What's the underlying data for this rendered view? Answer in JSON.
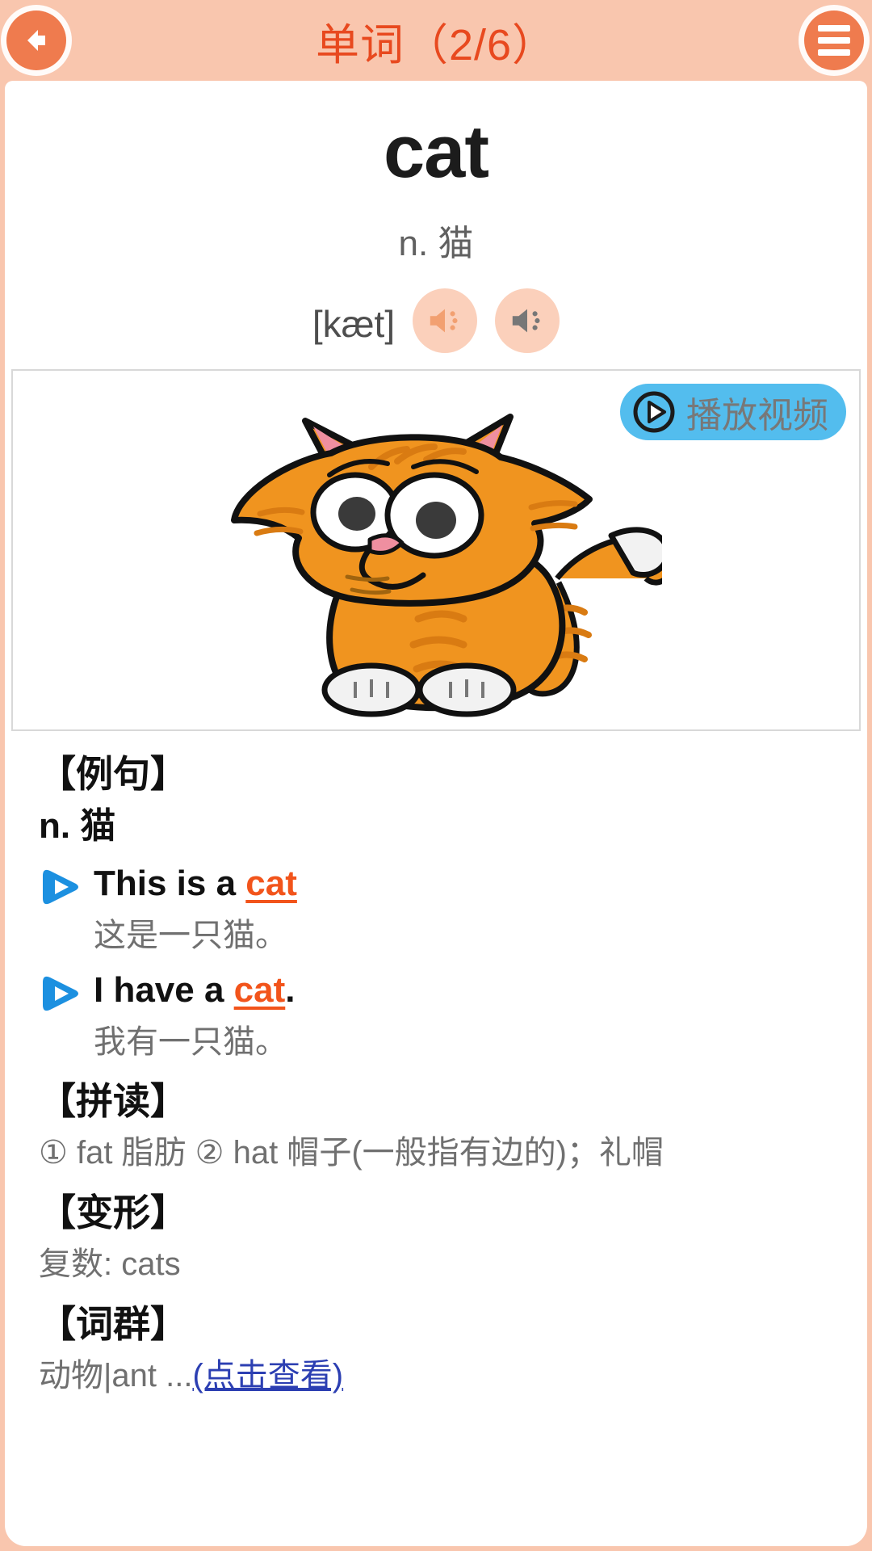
{
  "header": {
    "title": "单词（2/6）",
    "back_icon": "back-arrow-icon",
    "menu_icon": "hamburger-menu-icon",
    "accent_color": "#e8491f",
    "background_color": "#f9c6ae",
    "button_color": "#ef7b4e"
  },
  "word": {
    "term": "cat",
    "part_of_speech": "n. 猫",
    "phonetic": "[kæt]",
    "speaker_us_icon": "speaker-icon",
    "speaker_uk_icon": "speaker-icon",
    "speaker_us_color": "#f2a071",
    "speaker_uk_color": "#777777",
    "speaker_bg_color": "#fbd0bb"
  },
  "image_panel": {
    "illustration": "cartoon-orange-cat",
    "video_button": {
      "label": "播放视频",
      "icon": "play-circle-icon",
      "background_color": "#53bdee",
      "label_color": "#787878"
    }
  },
  "sections": {
    "examples": {
      "heading": "【例句】",
      "pos": "n. 猫",
      "items": [
        {
          "play_icon": "play-icon",
          "en_prefix": "This is a ",
          "en_highlight": "cat",
          "en_suffix": "",
          "cn": "这是一只猫。"
        },
        {
          "play_icon": "play-icon",
          "en_prefix": "I have a ",
          "en_highlight": "cat",
          "en_suffix": ".",
          "cn": "我有一只猫。"
        }
      ]
    },
    "spelling": {
      "heading": "【拼读】",
      "body": "① fat 脂肪 ② hat 帽子(一般指有边的)；礼帽"
    },
    "inflection": {
      "heading": "【变形】",
      "body": "复数: cats"
    },
    "word_group": {
      "heading": "【词群】",
      "body": "动物|ant ...",
      "link_label": "(点击查看)",
      "link_color": "#2c3fb2"
    }
  }
}
